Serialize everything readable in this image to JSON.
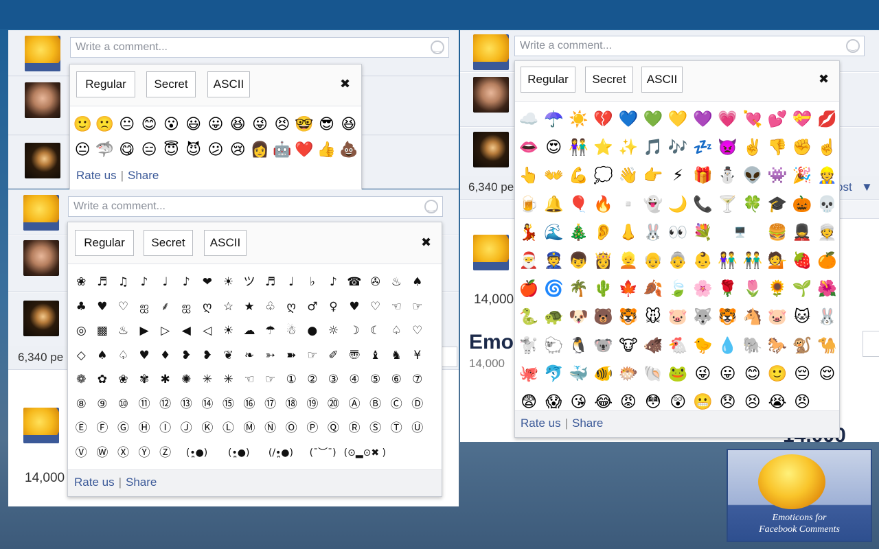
{
  "comment_placeholder": "Write a comment...",
  "tabs": {
    "regular": "Regular",
    "secret": "Secret",
    "ascii": "ASCII"
  },
  "close_symbol": "✖",
  "footer": {
    "rate": "Rate us",
    "separator": "|",
    "share": "Share"
  },
  "background_labels": {
    "people_count": "6,340 pe",
    "count_a": "14,000",
    "count_b": "14,000",
    "count_c": "14,000",
    "count_d": "14,00",
    "title_fragment": "Emo",
    "post_fragment": "ost",
    "big_number": "14.000"
  },
  "regular_emoticons": [
    "🙂",
    "🙁",
    "😐",
    "😊",
    "😮",
    "😃",
    "😛",
    "😆",
    "😜",
    "😣",
    "🤓",
    "😎",
    "😆",
    "😐",
    "🦈",
    "😋",
    "😑",
    "😇",
    "😈",
    "😕",
    "😢",
    "👩",
    "🤖",
    "❤️",
    "👍",
    "💩"
  ],
  "secret_emoticons": [
    "☁️",
    "☂️",
    "☀️",
    "💔",
    "💙",
    "💚",
    "💛",
    "💜",
    "💗",
    "💘",
    "💕",
    "💝",
    "💋",
    "👄",
    "😍",
    "👫",
    "⭐",
    "✨",
    "🎵",
    "🎶",
    "💤",
    "👿",
    "✌️",
    "👎",
    "✊",
    "☝️",
    "👆",
    "👐",
    "💪",
    "💭",
    "👋",
    "👉",
    "⚡",
    "🎁",
    "⛄",
    "👽",
    "👾",
    "🎉",
    "👷",
    "🍺",
    "🔔",
    "🎈",
    "🔥",
    "▫️",
    "👻",
    "🌙",
    "📞",
    "🍸",
    "🍀",
    "🎓",
    "🎃",
    "💀",
    "💃",
    "🌊",
    "🎄",
    "👂",
    "👃",
    "🐰",
    "👀",
    "💐",
    "🖥️",
    "🍔",
    "💂",
    "👳",
    "🎅",
    "👮",
    "👦",
    "👸",
    "👱",
    "👴",
    "👵",
    "👶",
    "👫",
    "👬",
    "💁",
    "🍓",
    "🍊",
    "🍎",
    "🌀",
    "🌴",
    "🌵",
    "🍁",
    "🍂",
    "🍃",
    "🌸",
    "🌹",
    "🌷",
    "🌻",
    "🌱",
    "🌺",
    "🐍",
    "🐢",
    "🐶",
    "🐻",
    "🐯",
    "🐭",
    "🐷",
    "🐺",
    "🐯",
    "🐴",
    "🐷",
    "🐱",
    "🐰",
    "🐩",
    "🐑",
    "🐧",
    "🐨",
    "🐮",
    "🐗",
    "🐔",
    "🐤",
    "💧",
    "🐘",
    "🐎",
    "🐒",
    "🐪",
    "🐙",
    "🐬",
    "🐳",
    "🐠",
    "🐡",
    "🐚",
    "🐸",
    "😜",
    "😛",
    "😊",
    "🙂",
    "😔",
    "😌",
    "😨",
    "😱",
    "😘",
    "😂",
    "😡",
    "😳",
    "😲",
    "😬",
    "😞",
    "😣",
    "😭",
    "😠"
  ],
  "ascii_emoticons": [
    "❀",
    "♬",
    "♫",
    "♪",
    "♩",
    "♪",
    "❤",
    "☀",
    "ツ",
    "♬",
    "♩",
    "♭",
    "♪",
    "☎",
    "✇",
    "♨",
    "♠",
    "♣",
    "♥",
    "♡",
    "ஐ",
    "⸙",
    "ஐ",
    "ღ",
    "☆",
    "★",
    "♧",
    "ღ",
    "♂",
    "♀",
    "♥",
    "♡",
    "☜",
    "☞",
    "◎",
    "▩",
    "♨",
    "▶",
    "▷",
    "◀",
    "◁",
    "☀",
    "☁",
    "☂",
    "☃",
    "●",
    "☼",
    "☽",
    "☾",
    "♤",
    "♡",
    "◇",
    "♠",
    "♤",
    "♥",
    "♦",
    "❥",
    "❥",
    "❦",
    "❧",
    "➳",
    "➽",
    "☞",
    "✐",
    "〠",
    "♝",
    "♞",
    "¥",
    "❁",
    "✿",
    "❀",
    "✾",
    "✱",
    "✺",
    "✳",
    "✳",
    "☜",
    "☞",
    "①",
    "②",
    "③",
    "④",
    "⑤",
    "⑥",
    "⑦",
    "⑧",
    "⑨",
    "⑩",
    "⑪",
    "⑫",
    "⑬",
    "⑭",
    "⑮",
    "⑯",
    "⑰",
    "⑱",
    "⑲",
    "⑳",
    "Ⓐ",
    "Ⓑ",
    "Ⓒ",
    "Ⓓ",
    "Ⓔ",
    "Ⓕ",
    "Ⓖ",
    "Ⓗ",
    "Ⓘ",
    "Ⓙ",
    "Ⓚ",
    "Ⓛ",
    "Ⓜ",
    "Ⓝ",
    "Ⓞ",
    "Ⓟ",
    "Ⓠ",
    "Ⓡ",
    "Ⓢ",
    "Ⓣ",
    "Ⓤ",
    "Ⓥ",
    "Ⓦ",
    "Ⓧ",
    "Ⓨ",
    "Ⓩ",
    "(•̪●)",
    "(•̪●)",
    "(/•̪●)",
    "(¯︶¯)",
    "(⊙▂⊙✖ )"
  ],
  "logo": {
    "line1": "Emoticons for",
    "line2": "Facebook Comments",
    "avatar_caption": "Emoticons for Facebook Comments"
  },
  "colors": {
    "link": "#3b5998",
    "background": "#1d5f96"
  }
}
